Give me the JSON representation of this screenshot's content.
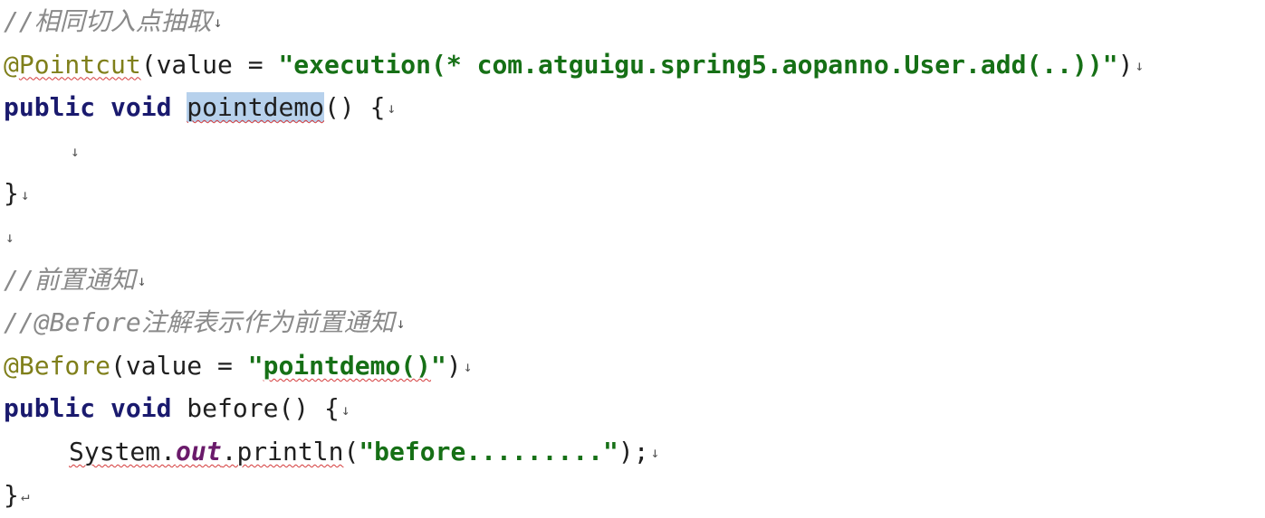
{
  "editor": {
    "lines": [
      {
        "tokens": [
          {
            "text": "//相同切入点抽取",
            "cls": "comment"
          },
          {
            "text": "↓",
            "cls": "mark"
          }
        ]
      },
      {
        "tokens": [
          {
            "text": "@",
            "cls": "anno"
          },
          {
            "text": "Pointcut",
            "cls": "anno squiggle"
          },
          {
            "text": "(value = ",
            "cls": "plain"
          },
          {
            "text": "\"execution(* com.atguigu.spring5.aopanno.User.add(..))\"",
            "cls": "str"
          },
          {
            "text": ")",
            "cls": "plain"
          },
          {
            "text": "↓",
            "cls": "mark"
          }
        ]
      },
      {
        "tokens": [
          {
            "text": "public void ",
            "cls": "kw"
          },
          {
            "text": "pointdemo",
            "cls": "plain squiggle selected"
          },
          {
            "text": "() {",
            "cls": "plain"
          },
          {
            "text": "↓",
            "cls": "mark"
          }
        ]
      },
      {
        "indent": true,
        "tokens": [
          {
            "text": "↓",
            "cls": "mark"
          }
        ]
      },
      {
        "tokens": [
          {
            "text": "}",
            "cls": "plain"
          },
          {
            "text": "↓",
            "cls": "mark"
          }
        ]
      },
      {
        "tokens": [
          {
            "text": "↓",
            "cls": "mark"
          }
        ]
      },
      {
        "tokens": [
          {
            "text": "//前置通知",
            "cls": "comment"
          },
          {
            "text": "↓",
            "cls": "mark"
          }
        ]
      },
      {
        "tokens": [
          {
            "text": "//@Before注解表示作为前置通知",
            "cls": "comment"
          },
          {
            "text": "↓",
            "cls": "mark"
          }
        ]
      },
      {
        "tokens": [
          {
            "text": "@Before",
            "cls": "anno"
          },
          {
            "text": "(value = ",
            "cls": "plain"
          },
          {
            "text": "\"",
            "cls": "str"
          },
          {
            "text": "pointdemo()",
            "cls": "str squiggle"
          },
          {
            "text": "\"",
            "cls": "str"
          },
          {
            "text": ")",
            "cls": "plain"
          },
          {
            "text": "↓",
            "cls": "mark"
          }
        ]
      },
      {
        "tokens": [
          {
            "text": "public void ",
            "cls": "kw"
          },
          {
            "text": "before",
            "cls": "plain"
          },
          {
            "text": "() {",
            "cls": "plain"
          },
          {
            "text": "↓",
            "cls": "mark"
          }
        ]
      },
      {
        "indent": true,
        "tokens": [
          {
            "text": "System.",
            "cls": "plain squiggle"
          },
          {
            "text": "out",
            "cls": "field squiggle"
          },
          {
            "text": ".println",
            "cls": "plain squiggle"
          },
          {
            "text": "(",
            "cls": "plain"
          },
          {
            "text": "\"before.........\"",
            "cls": "str"
          },
          {
            "text": ");",
            "cls": "plain"
          },
          {
            "text": "↓",
            "cls": "mark"
          }
        ]
      },
      {
        "tokens": [
          {
            "text": "}",
            "cls": "plain"
          },
          {
            "text": "↵",
            "cls": "mark"
          }
        ]
      }
    ]
  }
}
